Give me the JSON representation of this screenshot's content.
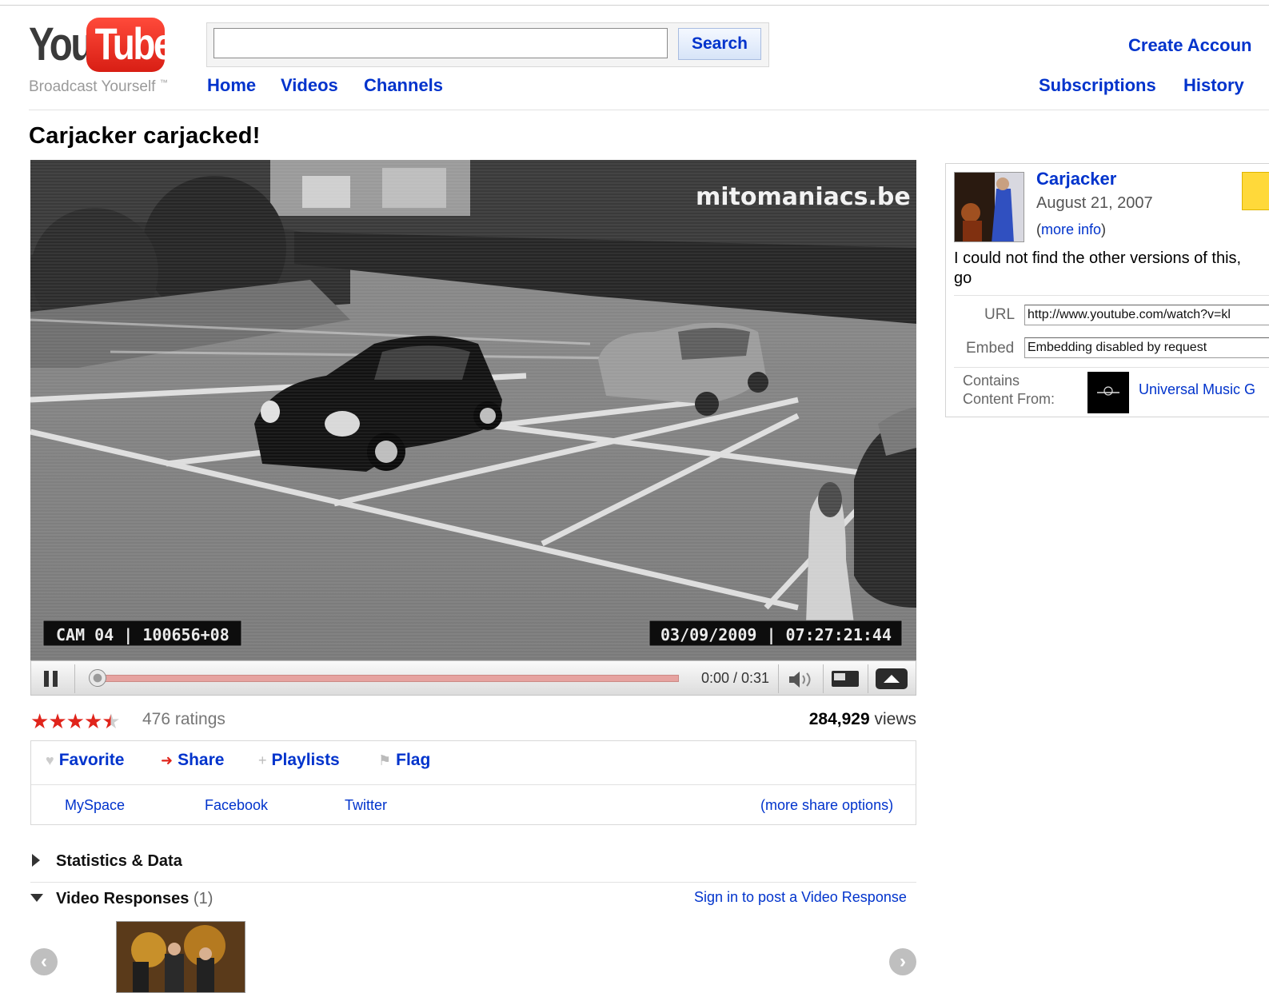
{
  "header": {
    "logo_you": "You",
    "logo_tube": "Tube",
    "tagline": "Broadcast Yourself",
    "tagline_tm": "™",
    "search": {
      "value": "",
      "button_label": "Search"
    },
    "nav": [
      "Home",
      "Videos",
      "Channels"
    ],
    "create_account": "Create Accoun",
    "subscriptions": "Subscriptions",
    "history": "History"
  },
  "video": {
    "title": "Carjacker carjacked!",
    "watermark": "mitomaniacs.be",
    "cam_label": "CAM 04 | 100656+08",
    "timestamp": "03/09/2009 | 07:27:21:44",
    "time": "0:00 / 0:31",
    "progress_fraction": 0.0,
    "loaded_fraction": 1.0
  },
  "stats": {
    "stars": 4.5,
    "ratings": "476 ratings",
    "views_count": "284,929",
    "views_label": "views"
  },
  "actions": {
    "favorite": "Favorite",
    "share": "Share",
    "playlists": "Playlists",
    "flag": "Flag",
    "share_links": [
      "MySpace",
      "Facebook",
      "Twitter"
    ],
    "more_share": "(more share options)"
  },
  "sections": {
    "statistics": "Statistics & Data",
    "responses": "Video Responses",
    "responses_count": "(1)",
    "sign_in_response": "Sign in to post a Video Response"
  },
  "sidebar": {
    "username": "Carjacker",
    "date": "August 21, 2007",
    "more_info_open": "(",
    "more_info": "more info",
    "more_info_close": ")",
    "description_line1": "I could not find the other versions of this,",
    "description_line2": "go",
    "url_label": "URL",
    "url_value": "http://www.youtube.com/watch?v=kl",
    "embed_label": "Embed",
    "embed_value": "Embedding disabled by request",
    "contains_label_1": "Contains",
    "contains_label_2": "Content From:",
    "content_owner": "Universal Music G"
  },
  "colors": {
    "link": "#0033cc",
    "brand_red": "#e0241b",
    "progress": "#e6a3a0"
  }
}
